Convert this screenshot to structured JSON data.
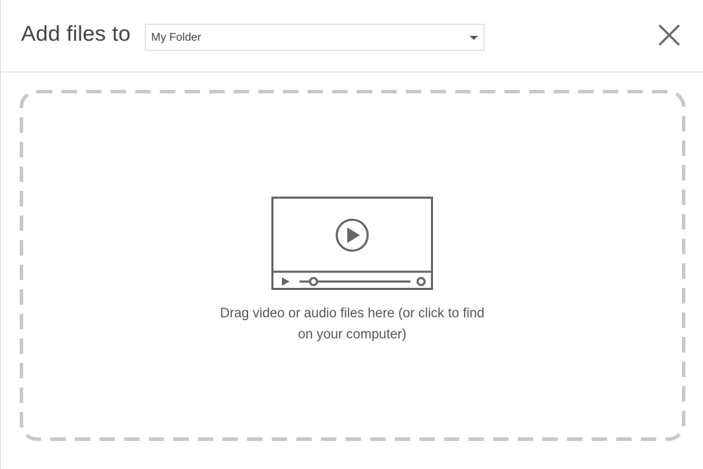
{
  "header": {
    "title": "Add files to",
    "folder_select": {
      "selected": "My Folder"
    },
    "close_icon": "close-icon"
  },
  "dropzone": {
    "icon": "video-player-icon",
    "text_line1": "Drag video or audio files here (or click to find",
    "text_line2": "on your computer)"
  },
  "colors": {
    "border": "#c8c8c8",
    "icon": "#666666",
    "text": "#555555",
    "title": "#444444"
  }
}
